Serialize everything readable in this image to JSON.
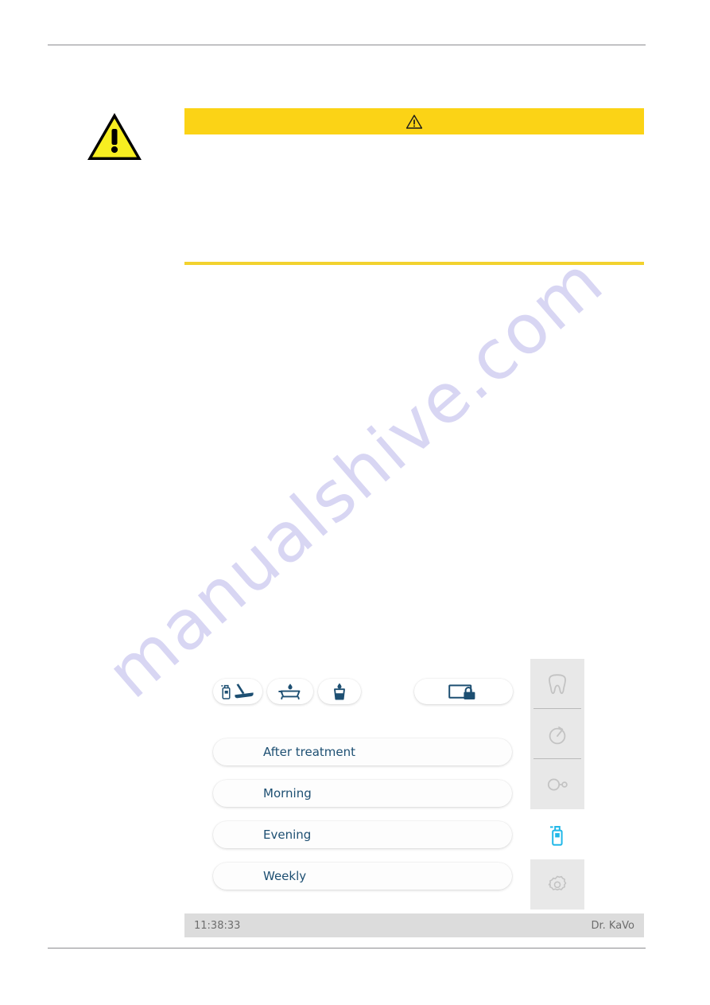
{
  "page": {
    "watermark": "manualshive.com"
  },
  "warning": {
    "icon": "warning-triangle-icon",
    "banner_icon": "warning-triangle-small-icon",
    "banner_text": "",
    "body_text": ""
  },
  "device_screen": {
    "toolbar": {
      "items": [
        {
          "icon": "spray-chair-icon",
          "label": ""
        },
        {
          "icon": "bowl-rinse-icon",
          "label": ""
        },
        {
          "icon": "cup-fill-icon",
          "label": ""
        }
      ],
      "lock": {
        "icon": "screen-lock-icon",
        "label": ""
      }
    },
    "programs": [
      {
        "label": "After treatment"
      },
      {
        "label": "Morning"
      },
      {
        "label": "Evening"
      },
      {
        "label": "Weekly"
      }
    ],
    "side_rail": [
      {
        "icon": "tooth-icon",
        "active": false
      },
      {
        "icon": "stopwatch-icon",
        "active": false
      },
      {
        "icon": "endo-infinity-icon",
        "active": false
      },
      {
        "icon": "spray-bottle-icon",
        "active": true
      },
      {
        "icon": "gear-icon",
        "active": false
      }
    ],
    "status_bar": {
      "time": "11:38:33",
      "user": "Dr. KaVo"
    }
  },
  "colors": {
    "warning_yellow": "#fbd316",
    "underline_yellow": "#f2d22e",
    "accent_blue": "#1d4f72",
    "active_cyan": "#22b8e8",
    "status_bar_bg": "#dcdcdc",
    "rail_bg": "#e8e8e8",
    "watermark": "#d8d6f3"
  }
}
